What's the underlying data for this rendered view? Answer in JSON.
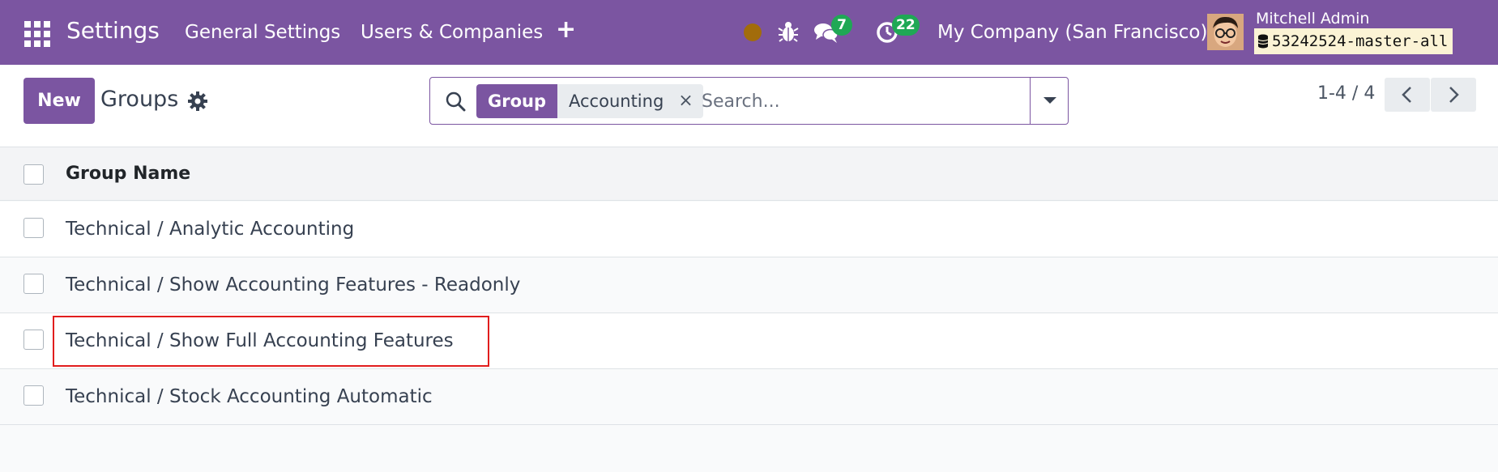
{
  "navbar": {
    "brand": "Settings",
    "menu": [
      {
        "label": "General Settings"
      },
      {
        "label": "Users & Companies"
      }
    ],
    "icons": [
      "apps-icon",
      "plus-icon",
      "bug-icon",
      "chat-icon",
      "clock-icon"
    ],
    "chat_badge": "7",
    "activity_badge": "22",
    "company": "My Company (San Francisco)",
    "user_name": "Mitchell Admin",
    "database": "53242524-master-all"
  },
  "control_panel": {
    "new_label": "New",
    "title": "Groups",
    "search": {
      "facet_label": "Group",
      "facet_value": "Accounting",
      "facet_remove": "×",
      "placeholder": "Search..."
    },
    "pager": "1-4 / 4"
  },
  "list": {
    "column_header": "Group Name",
    "rows": [
      {
        "name": "Technical / Analytic Accounting"
      },
      {
        "name": "Technical / Show Accounting Features - Readonly"
      },
      {
        "name": "Technical / Show Full Accounting Features"
      },
      {
        "name": "Technical / Stock Accounting Automatic"
      }
    ]
  },
  "colors": {
    "brand": "#7b55a1",
    "badge": "#1fa855",
    "highlight": "#e11d1d"
  }
}
